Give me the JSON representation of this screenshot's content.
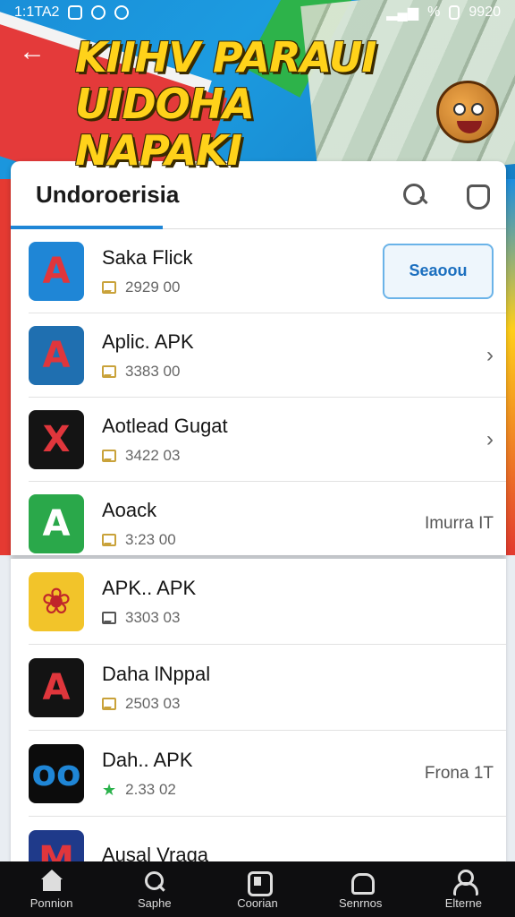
{
  "status_bar": {
    "time": "1:1TA2",
    "right": "%",
    "battery": "9920"
  },
  "banner": {
    "headline_line1": "KIIHV PARAUI",
    "headline_line2": "UIDOHA NAPAKI"
  },
  "card": {
    "title": "Undoroerisia"
  },
  "apps": [
    {
      "name": "Saka Flick",
      "sub": "2929 00",
      "action": "button",
      "action_label": "Seaoou",
      "icon_bg": "#1f86d6",
      "icon_fg": "#e0363c",
      "icon_glyph": "A"
    },
    {
      "name": "Aplic. APK",
      "sub": "3383 00",
      "action": "chevron",
      "icon_bg": "#1f6fb0",
      "icon_fg": "#e0363c",
      "icon_glyph": "A"
    },
    {
      "name": "Aotlead Gugat",
      "sub": "3422 03",
      "action": "chevron",
      "icon_bg": "#141414",
      "icon_fg": "#e0363c",
      "icon_glyph": "X"
    },
    {
      "name": "Aoack",
      "sub": "3:23 00",
      "action": "text",
      "action_label": "Imurra IT",
      "icon_bg": "#2aa84a",
      "icon_fg": "#ffffff",
      "icon_glyph": "A"
    }
  ],
  "apps2": [
    {
      "name": "APK.. APK",
      "sub": "3303 03",
      "sub_icon": "dark",
      "action": "none",
      "icon_bg": "#f2c42a",
      "icon_fg": "#c0262a",
      "icon_glyph": "❀"
    },
    {
      "name": "Daha lNppal",
      "sub": "2503 03",
      "sub_icon": "gold",
      "action": "none",
      "icon_bg": "#131313",
      "icon_fg": "#e0363c",
      "icon_glyph": "A"
    },
    {
      "name": "Dah.. APK",
      "sub": "2.33 02",
      "sub_icon": "star",
      "action": "text",
      "action_label": "Frona 1T",
      "icon_bg": "#0c0c0c",
      "icon_fg": "#1f86d6",
      "icon_glyph": "oo"
    },
    {
      "name": "Ausal Vraga",
      "sub": "",
      "sub_icon": "none",
      "action": "none",
      "icon_bg": "#1f3a8a",
      "icon_fg": "#e0363c",
      "icon_glyph": "M"
    }
  ],
  "bottom_nav": [
    {
      "label": "Ponnion",
      "icon": "home-icon"
    },
    {
      "label": "Saphe",
      "icon": "search-icon"
    },
    {
      "label": "Coorian",
      "icon": "app-icon"
    },
    {
      "label": "Senrnos",
      "icon": "service-icon"
    },
    {
      "label": "Elterne",
      "icon": "user-icon"
    }
  ]
}
